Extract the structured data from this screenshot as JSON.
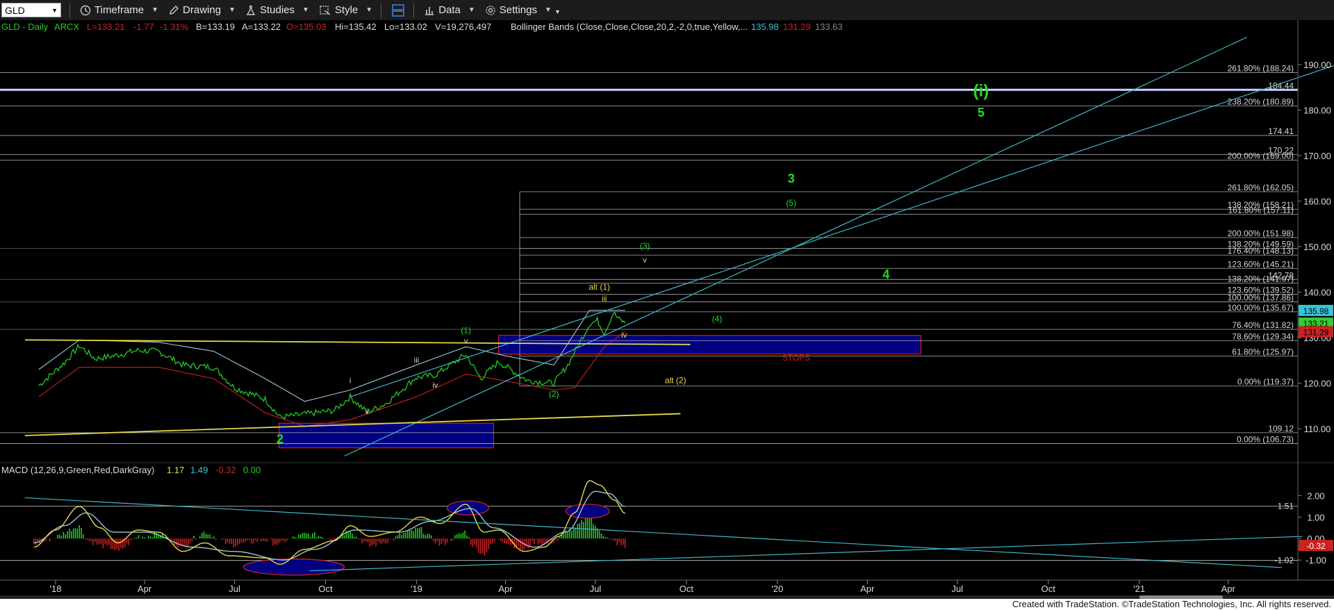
{
  "toolbar": {
    "symbol": "GLD",
    "timeframe": "Timeframe",
    "drawing": "Drawing",
    "studies": "Studies",
    "style": "Style",
    "data": "Data",
    "settings": "Settings"
  },
  "colors": {
    "price_up": "#22cc22",
    "price_down": "#cc2222",
    "bollinger_upper": "#9cc6d8",
    "bollinger_lower": "#cc1f1f",
    "zone_fill": "#000080",
    "zone_border": "#cc2222",
    "fib_line": "#cccccc",
    "trendline_cyan": "#3fb8c8",
    "trendline_yellow": "#e6dc4a",
    "label_green": "#22dd22",
    "label_yellow": "#e6dc4a",
    "label_white": "#dddddd",
    "stops": "#cc2222",
    "current_price_badge": "#33cc33",
    "last_price_badge": "#36c4d8"
  },
  "header": {
    "title": "GLD - Daily",
    "exchange": "ARCX",
    "last": "L=133.21",
    "change": "-1.77",
    "change_pct": "-1.31%",
    "bid": "B=133.19",
    "ask": "A=133.22",
    "open": "O=135.03",
    "high": "Hi=135.42",
    "low": "Lo=133.02",
    "volume": "V=19,276,497",
    "indicator": "Bollinger Bands (Close,Close,Close,20,2,-2,0,true,Yellow,...",
    "bb_upper": "135.98",
    "bb_lower": "131.29",
    "bb_mid": "133.63"
  },
  "macd_header": {
    "title": "MACD (12,26,9,Green,Red,DarkGray)",
    "macd": "1.17",
    "signal": "1.49",
    "diff": "-0.32",
    "zero": "0.00"
  },
  "footer_text": "Created with TradeStation. ©TradeStation Technologies, Inc. All rights reserved.",
  "chart_data": {
    "type": "line",
    "instrument": "GLD",
    "x_axis": {
      "ticks": [
        "'18",
        "Apr",
        "Jul",
        "Oct",
        "'19",
        "Apr",
        "Jul",
        "Oct",
        "'20",
        "Apr",
        "Jul",
        "Oct",
        "'21",
        "Apr"
      ]
    },
    "y_axis": {
      "ticks": [
        "190.00",
        "180.00",
        "170.00",
        "160.00",
        "150.00",
        "140.00",
        "130.00",
        "120.00",
        "110.00"
      ],
      "range": [
        103.6,
        194.4
      ]
    },
    "price_badges": [
      {
        "value": "135.98",
        "color": "#36c4d8"
      },
      {
        "value": "133.21",
        "color": "#33cc33"
      },
      {
        "value": "131.29",
        "color": "#cc2222"
      }
    ],
    "price_series": [
      {
        "date": "2017-12-15",
        "close": 119.5
      },
      {
        "date": "2018-01-10",
        "close": 124.5
      },
      {
        "date": "2018-01-25",
        "close": 128.2
      },
      {
        "date": "2018-02-10",
        "close": 125.4
      },
      {
        "date": "2018-03-01",
        "close": 126.0
      },
      {
        "date": "2018-03-25",
        "close": 127.2
      },
      {
        "date": "2018-04-15",
        "close": 127.0
      },
      {
        "date": "2018-05-10",
        "close": 124.0
      },
      {
        "date": "2018-06-10",
        "close": 123.5
      },
      {
        "date": "2018-07-01",
        "close": 119.0
      },
      {
        "date": "2018-08-01",
        "close": 116.5
      },
      {
        "date": "2018-08-16",
        "close": 112.5
      },
      {
        "date": "2018-09-10",
        "close": 113.2
      },
      {
        "date": "2018-10-10",
        "close": 114.0
      },
      {
        "date": "2018-10-26",
        "close": 117.0
      },
      {
        "date": "2018-11-12",
        "close": 113.6
      },
      {
        "date": "2018-12-01",
        "close": 115.5
      },
      {
        "date": "2018-12-31",
        "close": 121.2
      },
      {
        "date": "2019-01-20",
        "close": 121.8
      },
      {
        "date": "2019-02-20",
        "close": 126.3
      },
      {
        "date": "2019-03-07",
        "close": 121.0
      },
      {
        "date": "2019-03-25",
        "close": 124.7
      },
      {
        "date": "2019-04-23",
        "close": 120.6
      },
      {
        "date": "2019-05-20",
        "close": 120.0
      },
      {
        "date": "2019-06-03",
        "close": 124.0
      },
      {
        "date": "2019-06-25",
        "close": 133.0
      },
      {
        "date": "2019-07-03",
        "close": 133.8
      },
      {
        "date": "2019-07-10",
        "close": 131.0
      },
      {
        "date": "2019-07-19",
        "close": 135.4
      },
      {
        "date": "2019-07-25",
        "close": 134.0
      },
      {
        "date": "2019-07-31",
        "close": 133.2
      }
    ],
    "bollinger_upper": [
      {
        "date": "2017-12-15",
        "close": 123.0
      },
      {
        "date": "2018-01-25",
        "close": 129.5
      },
      {
        "date": "2018-04-15",
        "close": 129.0
      },
      {
        "date": "2018-06-10",
        "close": 127.0
      },
      {
        "date": "2018-08-01",
        "close": 121.0
      },
      {
        "date": "2018-09-10",
        "close": 116.0
      },
      {
        "date": "2018-10-26",
        "close": 118.5
      },
      {
        "date": "2019-01-01",
        "close": 124.0
      },
      {
        "date": "2019-02-20",
        "close": 128.0
      },
      {
        "date": "2019-04-01",
        "close": 126.0
      },
      {
        "date": "2019-05-20",
        "close": 124.0
      },
      {
        "date": "2019-06-25",
        "close": 136.0
      },
      {
        "date": "2019-07-31",
        "close": 136.0
      }
    ],
    "bollinger_lower": [
      {
        "date": "2017-12-15",
        "close": 117.0
      },
      {
        "date": "2018-01-25",
        "close": 123.5
      },
      {
        "date": "2018-04-15",
        "close": 123.5
      },
      {
        "date": "2018-06-10",
        "close": 121.0
      },
      {
        "date": "2018-08-01",
        "close": 113.5
      },
      {
        "date": "2018-09-10",
        "close": 110.5
      },
      {
        "date": "2018-10-26",
        "close": 112.0
      },
      {
        "date": "2019-01-01",
        "close": 117.0
      },
      {
        "date": "2019-02-20",
        "close": 122.0
      },
      {
        "date": "2019-04-01",
        "close": 120.5
      },
      {
        "date": "2019-05-20",
        "close": 118.5
      },
      {
        "date": "2019-06-10",
        "close": 119.0
      },
      {
        "date": "2019-07-10",
        "close": 128.0
      },
      {
        "date": "2019-07-31",
        "close": 131.3
      }
    ],
    "horizontal_levels": [
      {
        "label": "261.80% (188.24)",
        "value": 188.24
      },
      {
        "label": "184.44",
        "value": 184.44
      },
      {
        "label": "238.20% (180.89)",
        "value": 180.89
      },
      {
        "label": "174.41",
        "value": 174.41
      },
      {
        "label": "170.22",
        "value": 170.22
      },
      {
        "label": "200.00% (169.00)",
        "value": 169.0
      },
      {
        "label": "261.80% (162.05)",
        "value": 162.05
      },
      {
        "label": "138.20% (158.21)",
        "value": 158.21
      },
      {
        "label": "161.80% (157.11)",
        "value": 157.11
      },
      {
        "label": "200.00% (151.98)",
        "value": 151.98
      },
      {
        "label": "138.20% (149.59)",
        "value": 149.59
      },
      {
        "label": "176.40% (148.13)",
        "value": 148.13
      },
      {
        "label": "123.60% (145.21)",
        "value": 145.21
      },
      {
        "label": "142.78",
        "value": 142.78
      },
      {
        "label": "138.20% (141.97)",
        "value": 141.97
      },
      {
        "label": "123.60% (139.52)",
        "value": 139.52
      },
      {
        "label": "100.00% (137.86)",
        "value": 137.86
      },
      {
        "label": "100.00% (135.67)",
        "value": 135.67
      },
      {
        "label": "76.40% (131.82)",
        "value": 131.82
      },
      {
        "label": "78.60% (129.34)",
        "value": 129.34
      },
      {
        "label": "61.80% (125.97)",
        "value": 125.97
      },
      {
        "label": "0.00% (119.37)",
        "value": 119.37
      },
      {
        "label": "109.12",
        "value": 109.12
      },
      {
        "label": "0.00% (106.73)",
        "value": 106.73
      }
    ],
    "wave_labels": [
      {
        "text": "(i)",
        "date": "2020-07-25",
        "price": 183.0,
        "color": "#22dd22",
        "size": 24
      },
      {
        "text": "5",
        "date": "2020-07-25",
        "price": 178.5,
        "color": "#22dd22",
        "size": 18
      },
      {
        "text": "3",
        "date": "2020-01-15",
        "price": 164.0,
        "color": "#22dd22",
        "size": 18
      },
      {
        "text": "(5)",
        "date": "2020-01-15",
        "price": 159.0,
        "color": "#22dd22",
        "size": 12
      },
      {
        "text": "(3)",
        "date": "2019-08-20",
        "price": 149.5,
        "color": "#22dd22",
        "size": 12
      },
      {
        "text": "v",
        "date": "2019-08-20",
        "price": 146.5,
        "color": "#e6dc4a",
        "size": 11
      },
      {
        "text": "4",
        "date": "2020-04-20",
        "price": 143.0,
        "color": "#22dd22",
        "size": 18
      },
      {
        "text": "alt (1)",
        "date": "2019-07-05",
        "price": 140.5,
        "color": "#e6dc4a",
        "size": 12
      },
      {
        "text": "iii",
        "date": "2019-07-10",
        "price": 138.0,
        "color": "#e6dc4a",
        "size": 11
      },
      {
        "text": "(4)",
        "date": "2019-11-01",
        "price": 133.5,
        "color": "#22dd22",
        "size": 12
      },
      {
        "text": "iv",
        "date": "2019-07-30",
        "price": 130.0,
        "color": "#e6dc4a",
        "size": 11
      },
      {
        "text": "(1)",
        "date": "2019-02-20",
        "price": 131.0,
        "color": "#22dd22",
        "size": 12
      },
      {
        "text": "v",
        "date": "2019-02-20",
        "price": 128.7,
        "color": "#dddddd",
        "size": 11
      },
      {
        "text": "iii",
        "date": "2019-01-01",
        "price": 124.5,
        "color": "#dddddd",
        "size": 11
      },
      {
        "text": "i",
        "date": "2018-10-26",
        "price": 120.0,
        "color": "#dddddd",
        "size": 11
      },
      {
        "text": "iv",
        "date": "2019-01-20",
        "price": 119.0,
        "color": "#dddddd",
        "size": 11
      },
      {
        "text": "ii",
        "date": "2018-11-12",
        "price": 113.2,
        "color": "#dddddd",
        "size": 11
      },
      {
        "text": "(2)",
        "date": "2019-05-20",
        "price": 117.0,
        "color": "#22dd22",
        "size": 12
      },
      {
        "text": "alt (2)",
        "date": "2019-09-20",
        "price": 120.0,
        "color": "#e6dc4a",
        "size": 12
      },
      {
        "text": "2",
        "date": "2018-08-16",
        "price": 106.8,
        "color": "#22dd22",
        "size": 18
      },
      {
        "text": "STOPS",
        "date": "2020-01-20",
        "price": 125.0,
        "color": "#cc2222",
        "size": 12
      }
    ],
    "zones": [
      {
        "start": "2019-03-25",
        "end": "2020-05-25",
        "top": 130.5,
        "bottom": 126.4
      },
      {
        "start": "2018-08-15",
        "end": "2019-03-20",
        "top": 111.2,
        "bottom": 105.8
      }
    ],
    "trendlines": [
      {
        "color": "#3fb8c8",
        "start": {
          "date": "2018-10-20",
          "price": 104.0
        },
        "end": {
          "date": "2021-04-20",
          "price": 196.0
        }
      },
      {
        "color": "#3fb8c8",
        "start": {
          "date": "2018-10-26",
          "price": 117.0
        },
        "end": {
          "date": "2021-07-20",
          "price": 190.0
        }
      },
      {
        "color": "#e6dc4a",
        "start": {
          "date": "2017-12-01",
          "price": 108.5
        },
        "end": {
          "date": "2019-09-25",
          "price": 113.3
        }
      },
      {
        "color": "#e6dc4a",
        "start": {
          "date": "2017-12-01",
          "price": 129.5
        },
        "end": {
          "date": "2019-10-05",
          "price": 128.5
        }
      }
    ],
    "macd": {
      "y_ticks": [
        "2.00",
        "1.00",
        "0.00",
        "-1.00"
      ],
      "y_range": [
        -1.45,
        2.95
      ],
      "level_labels": [
        {
          "text": "1.51",
          "value": 1.51
        },
        {
          "text": "-1.02",
          "value": -1.02
        }
      ],
      "badge": {
        "text": "-0.32",
        "value": -0.32
      },
      "macd_series": [
        {
          "date": "2017-12-10",
          "v": -0.4
        },
        {
          "date": "2018-01-01",
          "v": 0.4
        },
        {
          "date": "2018-01-25",
          "v": 1.5
        },
        {
          "date": "2018-02-15",
          "v": 0.5
        },
        {
          "date": "2018-03-05",
          "v": -0.2
        },
        {
          "date": "2018-03-25",
          "v": 0.4
        },
        {
          "date": "2018-04-15",
          "v": 0.3
        },
        {
          "date": "2018-05-10",
          "v": -0.6
        },
        {
          "date": "2018-06-01",
          "v": -0.2
        },
        {
          "date": "2018-06-25",
          "v": -0.8
        },
        {
          "date": "2018-08-01",
          "v": -0.9
        },
        {
          "date": "2018-08-16",
          "v": -1.2
        },
        {
          "date": "2018-09-10",
          "v": -0.5
        },
        {
          "date": "2018-10-10",
          "v": -0.1
        },
        {
          "date": "2018-10-26",
          "v": 0.6
        },
        {
          "date": "2018-11-15",
          "v": 0.1
        },
        {
          "date": "2018-12-10",
          "v": 0.3
        },
        {
          "date": "2019-01-05",
          "v": 1.0
        },
        {
          "date": "2019-01-25",
          "v": 0.7
        },
        {
          "date": "2019-02-20",
          "v": 1.6
        },
        {
          "date": "2019-03-10",
          "v": 0.3
        },
        {
          "date": "2019-03-25",
          "v": 0.4
        },
        {
          "date": "2019-04-20",
          "v": -0.6
        },
        {
          "date": "2019-05-10",
          "v": -0.4
        },
        {
          "date": "2019-05-25",
          "v": 0.1
        },
        {
          "date": "2019-06-10",
          "v": 1.2
        },
        {
          "date": "2019-06-25",
          "v": 2.7
        },
        {
          "date": "2019-07-05",
          "v": 2.5
        },
        {
          "date": "2019-07-20",
          "v": 1.8
        },
        {
          "date": "2019-07-31",
          "v": 1.17
        }
      ],
      "signal_series": [
        {
          "date": "2017-12-10",
          "v": -0.2
        },
        {
          "date": "2018-01-10",
          "v": 0.6
        },
        {
          "date": "2018-02-01",
          "v": 1.2
        },
        {
          "date": "2018-03-01",
          "v": 0.3
        },
        {
          "date": "2018-04-01",
          "v": 0.3
        },
        {
          "date": "2018-05-20",
          "v": -0.4
        },
        {
          "date": "2018-07-01",
          "v": -0.6
        },
        {
          "date": "2018-08-20",
          "v": -1.0
        },
        {
          "date": "2018-09-20",
          "v": -0.5
        },
        {
          "date": "2018-11-01",
          "v": 0.4
        },
        {
          "date": "2018-12-15",
          "v": 0.3
        },
        {
          "date": "2019-01-15",
          "v": 0.8
        },
        {
          "date": "2019-02-25",
          "v": 1.4
        },
        {
          "date": "2019-03-20",
          "v": 0.5
        },
        {
          "date": "2019-05-01",
          "v": -0.4
        },
        {
          "date": "2019-06-01",
          "v": 0.3
        },
        {
          "date": "2019-07-01",
          "v": 2.2
        },
        {
          "date": "2019-07-15",
          "v": 2.1
        },
        {
          "date": "2019-07-31",
          "v": 1.49
        }
      ],
      "ellipses": [
        {
          "start": "2019-02-01",
          "end": "2019-03-15",
          "top": 1.75,
          "bottom": 1.1
        },
        {
          "start": "2019-06-01",
          "end": "2019-07-15",
          "top": 1.6,
          "bottom": 0.95
        },
        {
          "start": "2018-07-10",
          "end": "2018-10-20",
          "top": -0.95,
          "bottom": -1.7
        }
      ],
      "trendlines": [
        {
          "start": {
            "date": "2017-12-01",
            "v": 1.9
          },
          "end": {
            "date": "2021-05-25",
            "v": -1.35
          }
        },
        {
          "start": {
            "date": "2018-09-15",
            "v": -1.5
          },
          "end": {
            "date": "2021-06-15",
            "v": 0.1
          }
        }
      ]
    }
  }
}
